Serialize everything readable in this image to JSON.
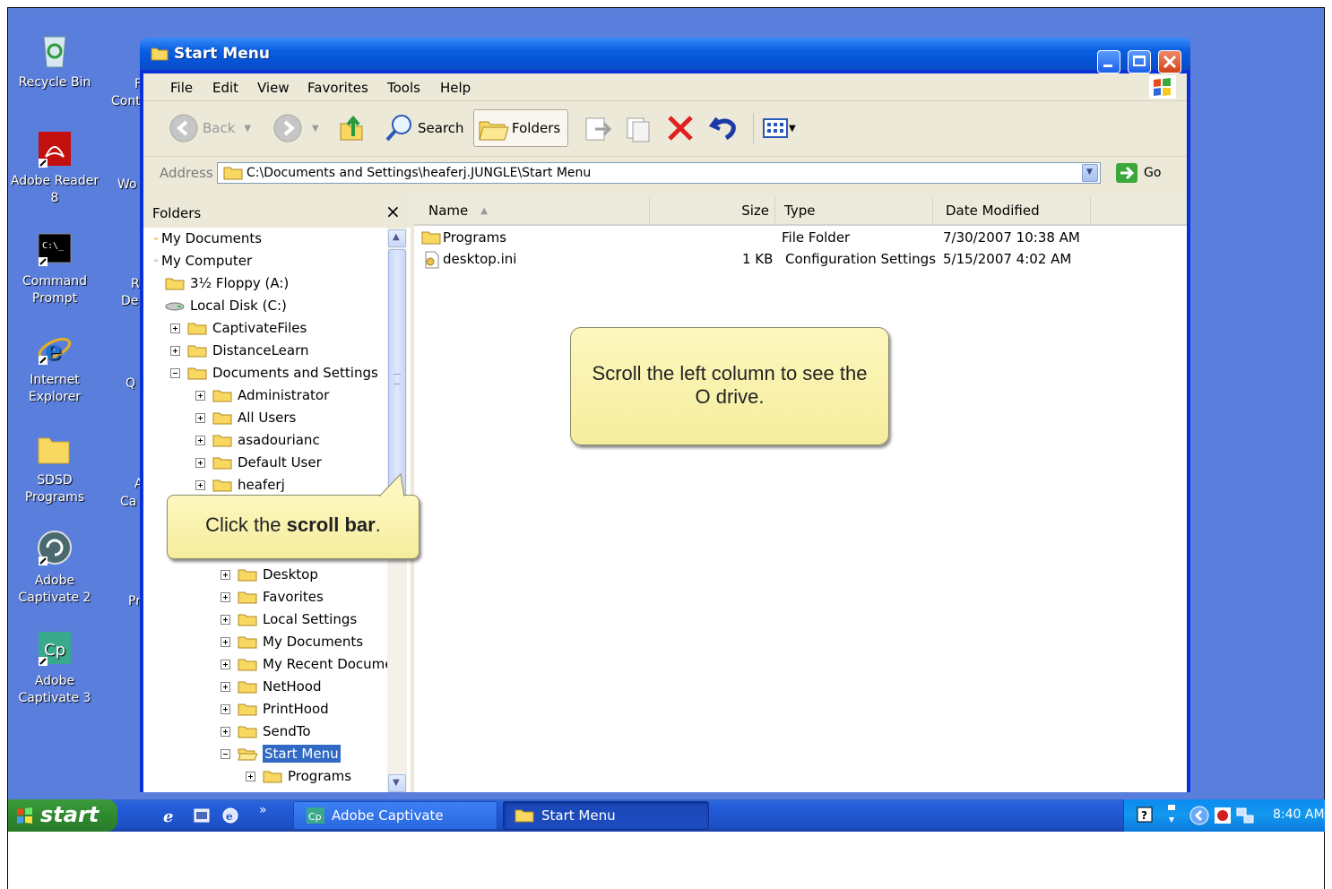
{
  "desktop": {
    "icons": [
      {
        "label": "Recycle Bin",
        "icon": "recycle-bin-icon"
      },
      {
        "label": "Adobe Reader 8",
        "icon": "adobe-reader-icon"
      },
      {
        "label": "Command Prompt",
        "icon": "command-prompt-icon"
      },
      {
        "label": "Internet Explorer",
        "icon": "internet-explorer-icon"
      },
      {
        "label": "SDSD Programs",
        "icon": "folder-icon"
      },
      {
        "label": "Adobe Captivate 2",
        "icon": "captivate2-icon"
      },
      {
        "label": "Adobe Captivate 3",
        "icon": "captivate3-icon"
      }
    ],
    "peek_labels": [
      "F",
      "Cont",
      "Wo",
      "R",
      "De",
      "Q",
      "A",
      "Ca",
      "Pr"
    ]
  },
  "window": {
    "title": "Start Menu",
    "menu": [
      "File",
      "Edit",
      "View",
      "Favorites",
      "Tools",
      "Help"
    ],
    "toolbar": {
      "back": "Back",
      "search": "Search",
      "folders": "Folders"
    },
    "address_label": "Address",
    "address_value": "C:\\Documents and Settings\\heaferj.JUNGLE\\Start Menu",
    "go_label": "Go"
  },
  "folders_pane": {
    "title": "Folders",
    "close": "×",
    "items": [
      {
        "label": "My Documents"
      },
      {
        "label": "My Computer"
      },
      {
        "label": "3½ Floppy (A:)"
      },
      {
        "label": "Local Disk (C:)"
      },
      {
        "label": "CaptivateFiles"
      },
      {
        "label": "DistanceLearn"
      },
      {
        "label": "Documents and Settings"
      },
      {
        "label": "Administrator"
      },
      {
        "label": "All Users"
      },
      {
        "label": "asadourianc"
      },
      {
        "label": "Default User"
      },
      {
        "label": "heaferj"
      },
      {
        "label": "Desktop"
      },
      {
        "label": "Favorites"
      },
      {
        "label": "Local Settings"
      },
      {
        "label": "My Documents"
      },
      {
        "label": "My Recent Documen"
      },
      {
        "label": "NetHood"
      },
      {
        "label": "PrintHood"
      },
      {
        "label": "SendTo"
      },
      {
        "label": "Start Menu"
      },
      {
        "label": "Programs"
      }
    ]
  },
  "file_list": {
    "columns": [
      "Name",
      "Size",
      "Type",
      "Date Modified"
    ],
    "rows": [
      {
        "name": "Programs",
        "size": "",
        "type": "File Folder",
        "date": "7/30/2007 10:38 AM"
      },
      {
        "name": "desktop.ini",
        "size": "1 KB",
        "type": "Configuration Settings",
        "date": "5/15/2007 4:02 AM"
      }
    ]
  },
  "callouts": {
    "scroll_hint": "Scroll the left column to see the O drive.",
    "click_prefix": "Click the ",
    "click_bold": "scroll bar",
    "click_suffix": "."
  },
  "taskbar": {
    "start": "start",
    "tasks": [
      "Adobe Captivate",
      "Start Menu"
    ],
    "time": "8:40 AM"
  }
}
